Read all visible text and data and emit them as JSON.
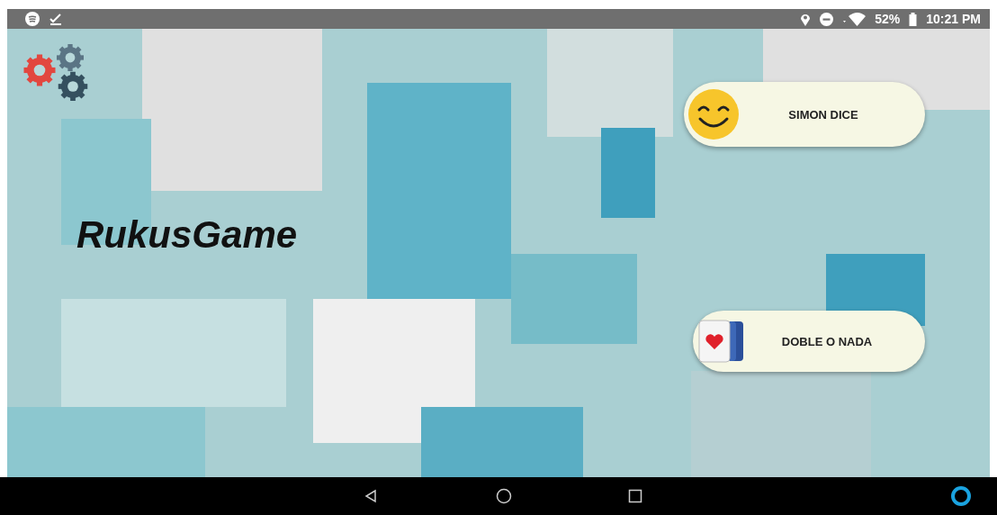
{
  "status_bar": {
    "battery": "52%",
    "time": "10:21 PM"
  },
  "title": "RukusGame",
  "games": [
    {
      "label": "SIMON DICE",
      "kind": "smiley"
    },
    {
      "label": "DOBLE O NADA",
      "kind": "cards"
    }
  ]
}
